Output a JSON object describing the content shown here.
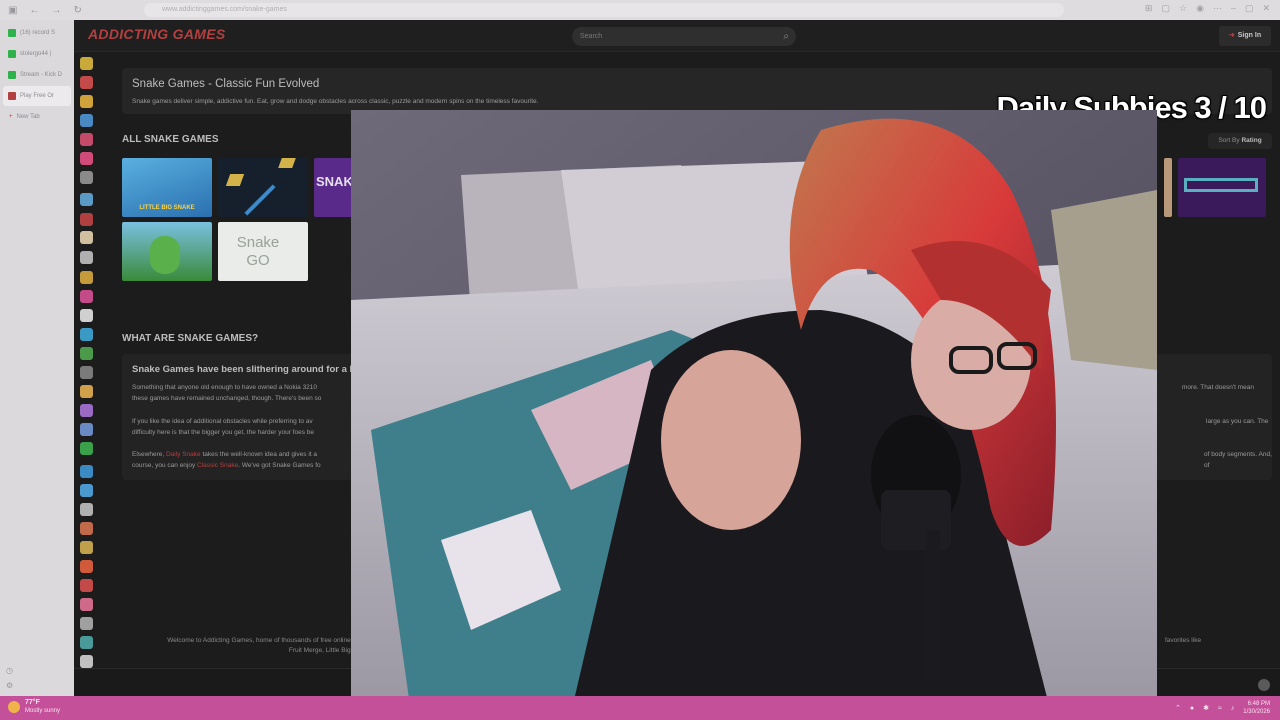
{
  "browser": {
    "url": "www.addictinggames.com/snake-games",
    "tabs": [
      {
        "label": "(16) record S",
        "color": "#2fb24b"
      },
      {
        "label": "stolergo44 |",
        "color": "#2fb24b"
      },
      {
        "label": "Stream - Kick D",
        "color": "#2fb24b"
      },
      {
        "label": "Play Free Or",
        "color": "#b34040"
      }
    ],
    "new_tab_label": "New Tab"
  },
  "site": {
    "logo": "ADDICTING GAMES",
    "search_placeholder": "Search",
    "sign_in_label": "Sign In"
  },
  "hero": {
    "title": "Snake Games - Classic Fun Evolved",
    "description": "Snake games deliver simple, addictive fun. Eat, grow and dodge obstacles across classic, puzzle and modern spins on the timeless favourite."
  },
  "games_section": {
    "title": "ALL SNAKE GAMES",
    "sort_prefix": "Sort By",
    "sort_value": "Rating",
    "games": [
      {
        "label": "LITTLE BIG SNAKE",
        "color": "#3b8fd0"
      },
      {
        "label": "",
        "color": "#1b2a3a"
      },
      {
        "label": "SNAKE",
        "color": "#5a2a8a"
      },
      {
        "label": "",
        "color": "#3a6a2a"
      },
      {
        "label": "Snake GO",
        "color": "#e9ece9"
      },
      {
        "label": "",
        "color": "#3a1a5a"
      }
    ]
  },
  "article": {
    "title": "WHAT ARE SNAKE GAMES?",
    "heading": "Snake Games have been slithering around for a lo",
    "p1_left": "Something that anyone old enough to have owned a Nokia 3210",
    "p1_left2": "these games have remained unchanged, though. There's been so",
    "p1_right": "more. That doesn't mean",
    "p2_left": "If you like the idea of additional obstacles while preferring to av",
    "p2_left2": "difficulty here is that the bigger you get, the harder your foes be",
    "p2_right": "large as you can. The",
    "p3_left_a": "Elsewhere, ",
    "p3_link1": "Daily Snake",
    "p3_left_b": " takes the well-known idea and gives it a",
    "p3_left2_a": "course, you can enjoy ",
    "p3_link2": "Classic Snake",
    "p3_left2_b": ". We've got Snake Games fo",
    "p3_right": "of body segments. And, of"
  },
  "footer": {
    "left_line1": "Welcome to Addicting Games, home of thousands of free online",
    "left_line2": "Fruit Merge, Little Big Sna",
    "right_line1": "favorites like"
  },
  "overlay": {
    "title": "Daily Subbies 3 / 10"
  },
  "taskbar": {
    "temp": "77°F",
    "condition": "Mostly sunny",
    "time": "6:48 PM",
    "date": "1/30/2026"
  },
  "colors": {
    "brand": "#b34040",
    "taskbar": "#c4509a",
    "page_bg": "#1c1c1c"
  }
}
